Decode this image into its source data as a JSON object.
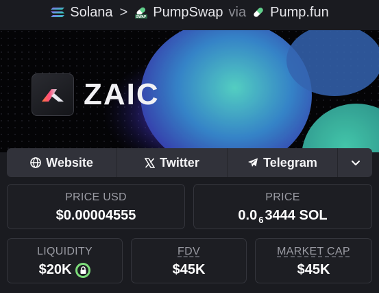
{
  "breadcrumb": {
    "chain": "Solana",
    "separator": ">",
    "dex": "PumpSwap",
    "dex_icon_text": "SWAP",
    "via": "via",
    "launchpad": "Pump.fun"
  },
  "banner": {
    "brand_text": "ZAIC"
  },
  "links": [
    {
      "label": "Website",
      "icon": "globe-icon"
    },
    {
      "label": "Twitter",
      "icon": "x-icon"
    },
    {
      "label": "Telegram",
      "icon": "telegram-icon"
    }
  ],
  "more_icon": "chevron-down-icon",
  "stats": {
    "price_usd": {
      "label": "PRICE USD",
      "value": "$0.00004555"
    },
    "price": {
      "label": "PRICE",
      "prefix": "0.0",
      "zeros": "6",
      "suffix": "3444 SOL"
    },
    "liquidity": {
      "label": "LIQUIDITY",
      "value": "$20K",
      "icon": "lock-icon"
    },
    "fdv": {
      "label": "FDV",
      "value": "$45K"
    },
    "market_cap": {
      "label": "MARKET CAP",
      "value": "$45K"
    }
  },
  "colors": {
    "background": "#1a1b20",
    "card": "#1d1e23",
    "link_bar": "#31323a",
    "lock_green": "#7ddc7a"
  }
}
